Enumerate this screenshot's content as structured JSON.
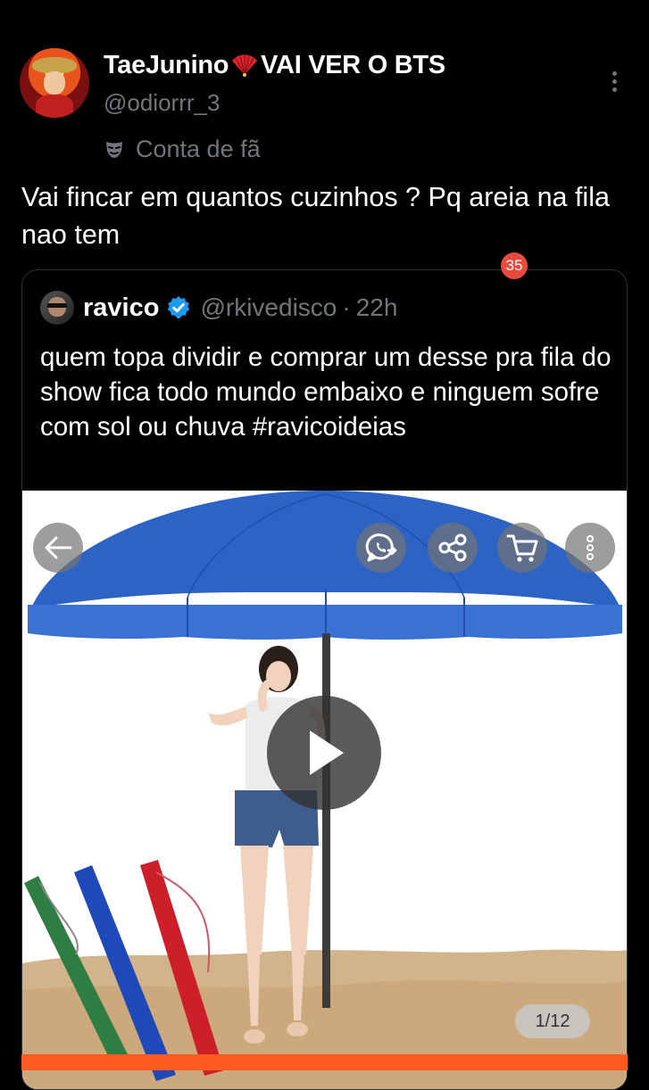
{
  "tweet": {
    "display_name_prefix": "TaeJunino",
    "display_name_suffix": "VAI VER O BTS",
    "handle": "@odiorrr_3",
    "label": "Conta de fã",
    "text": "Vai fincar em quantos cuzinhos ? Pq areia na fila nao tem"
  },
  "quote": {
    "name": "ravico",
    "handle": "@rkivedisco",
    "separator": "·",
    "time": "22h",
    "text": "quem topa dividir e comprar um desse pra fila do show fica todo mundo embaixo e ninguem sofre com sol ou chuva #ravicoideias",
    "media": {
      "cart_badge": "35",
      "page_counter": "1/12"
    }
  },
  "icons": [
    "fan-icon",
    "more-vert-icon",
    "mask-icon",
    "verified-icon",
    "back-arrow-icon",
    "whatsapp-share-icon",
    "share-icon",
    "cart-icon",
    "more-options-icon",
    "play-icon"
  ],
  "colors": {
    "background": "#000000",
    "text": "#ffffff",
    "secondary": "#71767b",
    "verified": "#1d9bf0",
    "umbrella": "#2d63c4",
    "badge": "#e84b3c",
    "accent_bar": "#ff5a1f"
  }
}
